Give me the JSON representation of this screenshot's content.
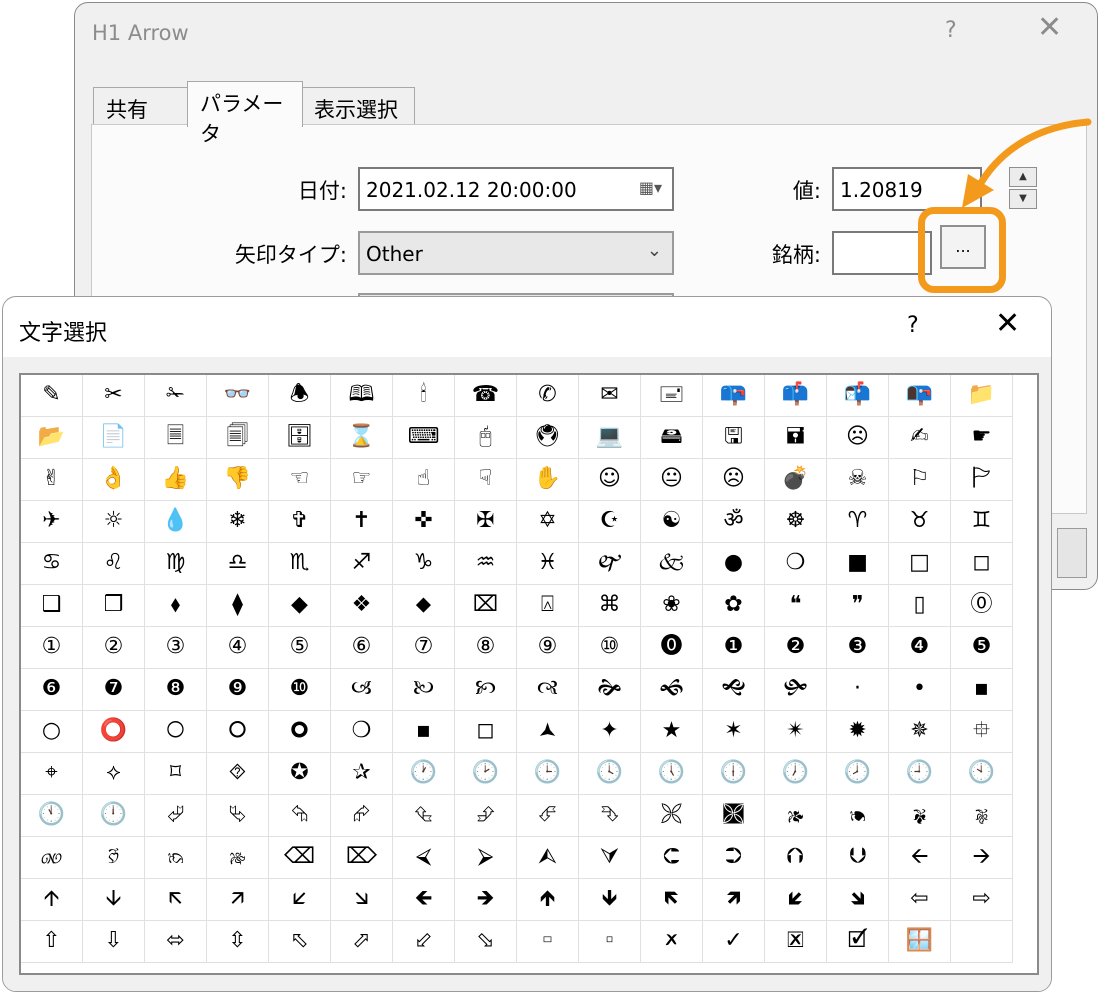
{
  "back_window": {
    "title": "H1 Arrow",
    "help": "?",
    "close": "✕",
    "tabs": [
      {
        "label": "共有",
        "active": false
      },
      {
        "label": "パラメータ",
        "active": true
      },
      {
        "label": "表示選択",
        "active": false
      }
    ],
    "date_label": "日付:",
    "date_value": "2021.02.12 20:00:00",
    "arrow_type_label": "矢印タイプ:",
    "arrow_type_value": "Other",
    "value_label": "値:",
    "value_value": "1.20819",
    "symbol_label": "銘柄:",
    "symbol_button": "..."
  },
  "char_dialog": {
    "title": "文字選択",
    "help": "?",
    "close": "✕",
    "symbols": [
      "✎",
      "✂",
      "✁",
      "👓",
      "🕭",
      "🕮",
      "🕯",
      "☎",
      "✆",
      "✉",
      "🖃",
      "📪",
      "📫",
      "📬",
      "📭",
      "📁",
      "📂",
      "📄",
      "🗏",
      "🗐",
      "🗄",
      "⌛",
      "⌨",
      "🖰",
      "🖲",
      "💻",
      "🖴",
      "🖫",
      "🖬",
      "☹",
      "✍",
      "☛",
      "✌",
      "👌",
      "👍",
      "👎",
      "☜",
      "☞",
      "☝",
      "☟",
      "✋",
      "☺",
      "😐",
      "☹",
      "💣",
      "☠",
      "⚐",
      "🏱",
      "✈",
      "☼",
      "💧",
      "❄",
      "✞",
      "✝",
      "✜",
      "✠",
      "✡",
      "☪",
      "☯",
      "ॐ",
      "☸",
      "♈",
      "♉",
      "♊",
      "♋",
      "♌",
      "♍",
      "♎",
      "♏",
      "♐",
      "♑",
      "♒",
      "♓",
      "🙰",
      "🙵",
      "●",
      "❍",
      "■",
      "□",
      "◻",
      "❑",
      "❒",
      "⬧",
      "⧫",
      "◆",
      "❖",
      "⬥",
      "⌧",
      "⍓",
      "⌘",
      "❀",
      "✿",
      "❝",
      "❞",
      "▯",
      "⓪",
      "①",
      "②",
      "③",
      "④",
      "⑤",
      "⑥",
      "⑦",
      "⑧",
      "⑨",
      "⑩",
      "⓿",
      "❶",
      "❷",
      "❸",
      "❹",
      "❺",
      "❻",
      "❼",
      "❽",
      "❾",
      "❿",
      "🙢",
      "🙠",
      "🙡",
      "🙣",
      "🙞",
      "🙜",
      "🙝",
      "🙟",
      "·",
      "•",
      "▪",
      "○",
      "⭕",
      "🞅",
      "🞆",
      "🞈",
      "❍",
      "▪",
      "◻",
      "🟂",
      "✦",
      "★",
      "✶",
      "✴",
      "✹",
      "✵",
      "⯐",
      "⌖",
      "⟡",
      "⌑",
      "⯑",
      "✪",
      "✰",
      "🕐",
      "🕑",
      "🕒",
      "🕓",
      "🕔",
      "🕕",
      "🕖",
      "🕗",
      "🕘",
      "🕙",
      "🕚",
      "🕛",
      "⮰",
      "⮱",
      "⮲",
      "⮳",
      "⮴",
      "⮵",
      "⮶",
      "⮷",
      "🙪",
      "🙫",
      "🙕",
      "🙔",
      "🙗",
      "🙖",
      "🙐",
      "🙑",
      "🙒",
      "🙓",
      "⌫",
      "⌦",
      "⮘",
      "⮚",
      "⮙",
      "⮛",
      "⮈",
      "⮊",
      "⮉",
      "⮋",
      "🡨",
      "🡪",
      "🡩",
      "🡫",
      "🡬",
      "🡭",
      "🡯",
      "🡮",
      "🡸",
      "🡺",
      "🡹",
      "🡻",
      "🡼",
      "🡽",
      "🡿",
      "🡾",
      "⇦",
      "⇨",
      "⇧",
      "⇩",
      "⬄",
      "⇳",
      "⬁",
      "⬀",
      "⬃",
      "⬂",
      "🢬",
      "🢭",
      "🗶",
      "✓",
      "🗷",
      "🗹",
      "🪟",
      ""
    ]
  }
}
